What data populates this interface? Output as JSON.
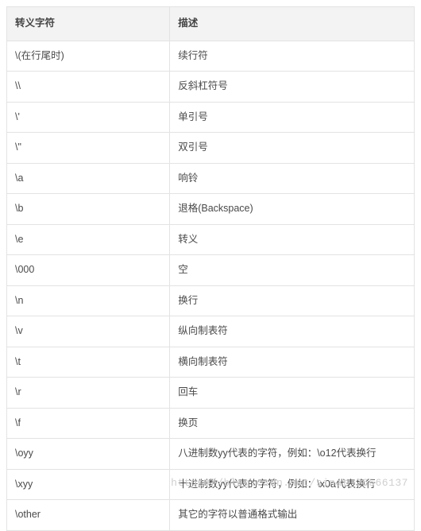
{
  "table": {
    "headers": {
      "escape": "转义字符",
      "description": "描述"
    },
    "rows": [
      {
        "escape": "\\(在行尾时)",
        "description": "续行符"
      },
      {
        "escape": "\\\\",
        "description": "反斜杠符号"
      },
      {
        "escape": "\\'",
        "description": "单引号"
      },
      {
        "escape": "\\\"",
        "description": "双引号"
      },
      {
        "escape": "\\a",
        "description": "响铃"
      },
      {
        "escape": "\\b",
        "description": "退格(Backspace)"
      },
      {
        "escape": "\\e",
        "description": "转义"
      },
      {
        "escape": "\\000",
        "description": "空"
      },
      {
        "escape": "\\n",
        "description": "换行"
      },
      {
        "escape": "\\v",
        "description": "纵向制表符"
      },
      {
        "escape": "\\t",
        "description": "横向制表符"
      },
      {
        "escape": "\\r",
        "description": "回车"
      },
      {
        "escape": "\\f",
        "description": "换页"
      },
      {
        "escape": "\\oyy",
        "description": "八进制数yy代表的字符，例如：\\o12代表换行"
      },
      {
        "escape": "\\xyy",
        "description": "十进制数yy代表的字符，例如：\\x0a代表换行"
      },
      {
        "escape": "\\other",
        "description": "其它的字符以普通格式输出"
      }
    ]
  },
  "watermark": "https://blog.csdn.net/sinat_26566137"
}
